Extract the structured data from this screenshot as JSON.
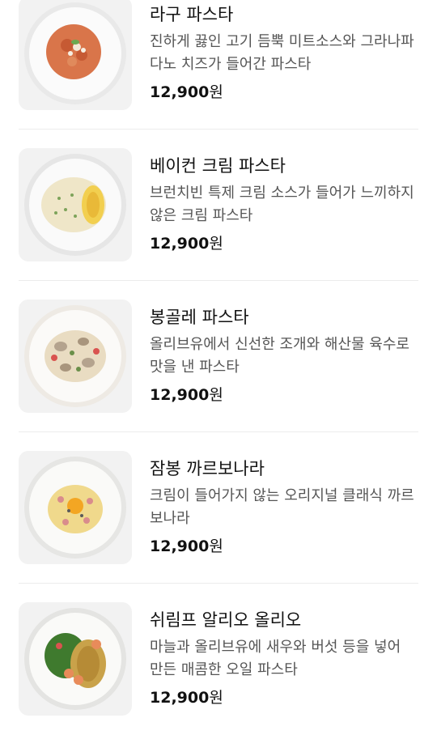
{
  "menu": {
    "items": [
      {
        "name": "라구 파스타",
        "description": "진하게 끓인 고기 듬뿍 미트소스와 그라나파다노 치즈가 들어간 파스타",
        "price": "12,900",
        "currency": "원",
        "image_icon": "ragu-pasta-dish-icon"
      },
      {
        "name": "베이컨 크림 파스타",
        "description": "브런치빈 특제 크림 소스가 들어가 느끼하지 않은 크림 파스타",
        "price": "12,900",
        "currency": "원",
        "image_icon": "bacon-cream-pasta-dish-icon"
      },
      {
        "name": "봉골레 파스타",
        "description": "올리브유에서 신선한 조개와 해산물 육수로 맛을 낸 파스타",
        "price": "12,900",
        "currency": "원",
        "image_icon": "vongole-pasta-dish-icon"
      },
      {
        "name": "잠봉 까르보나라",
        "description": "크림이 들어가지 않는 오리지널 클래식 까르보나라",
        "price": "12,900",
        "currency": "원",
        "image_icon": "jambon-carbonara-dish-icon"
      },
      {
        "name": "쉬림프 알리오 올리오",
        "description": "마늘과 올리브유에 새우와 버섯 등을 넣어 만든 매콤한 오일 파스타",
        "price": "12,900",
        "currency": "원",
        "image_icon": "shrimp-aglio-olio-dish-icon"
      }
    ]
  }
}
